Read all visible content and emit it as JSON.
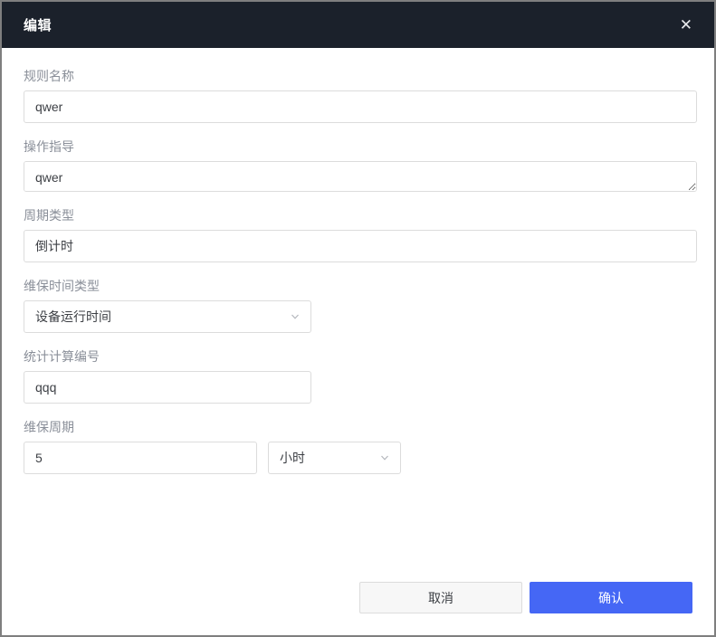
{
  "modal": {
    "title": "编辑",
    "close_icon": "✕"
  },
  "fields": {
    "rule_name": {
      "label": "规则名称",
      "value": "qwer"
    },
    "operation_guide": {
      "label": "操作指导",
      "value": "qwer"
    },
    "cycle_type": {
      "label": "周期类型",
      "value": "倒计时"
    },
    "maintenance_time_type": {
      "label": "维保时间类型",
      "value": "设备运行时间"
    },
    "stat_calc_number": {
      "label": "统计计算编号",
      "value": "qqq"
    },
    "maintenance_cycle": {
      "label": "维保周期",
      "value": "5",
      "unit": "小时"
    }
  },
  "footer": {
    "cancel_label": "取消",
    "confirm_label": "确认"
  },
  "colors": {
    "header_bg": "#1b212b",
    "confirm_bg": "#4567f5",
    "label_text": "#8a8f99",
    "input_border": "#dcdcdc"
  }
}
